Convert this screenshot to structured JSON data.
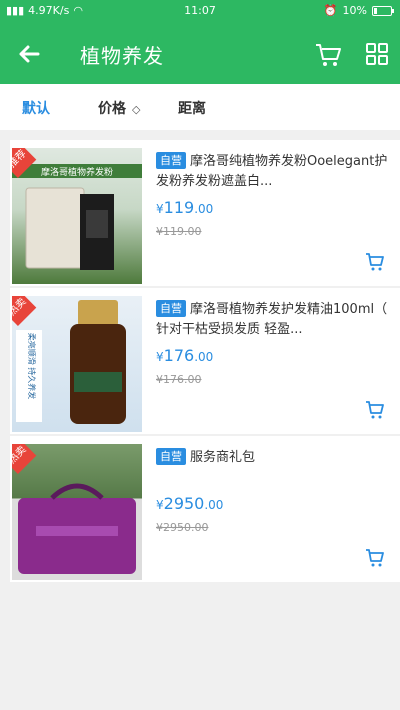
{
  "status_bar": {
    "network": "4.97K/s",
    "time": "11:07",
    "battery": "10%"
  },
  "header": {
    "title": "植物养发"
  },
  "sort_tabs": [
    {
      "label": "默认",
      "active": true
    },
    {
      "label": "价格",
      "active": false
    },
    {
      "label": "距离",
      "active": false
    }
  ],
  "sort_arrow": "◇",
  "products": [
    {
      "tag": "自营",
      "title": "摩洛哥纯植物养发粉Ooelegant护发粉养发粉遮盖白...",
      "price_symbol": "¥",
      "price_int": "119",
      "price_dec": ".00",
      "old_price": "¥119.00",
      "badge": "推荐",
      "thumb_caption": "摩洛哥植物养发粉"
    },
    {
      "tag": "自营",
      "title": "摩洛哥植物养发护发精油100ml（ 针对干枯受损发质 轻盈...",
      "price_symbol": "¥",
      "price_int": "176",
      "price_dec": ".00",
      "old_price": "¥176.00",
      "badge": "热卖",
      "thumb_caption": "柔亮顺滑 持久养发"
    },
    {
      "tag": "自营",
      "title": "服务商礼包",
      "price_symbol": "¥",
      "price_int": "2950",
      "price_dec": ".00",
      "old_price": "¥2950.00",
      "badge": "热卖",
      "thumb_caption": ""
    }
  ],
  "colors": {
    "brand_green": "#2db862",
    "accent_blue": "#2a8de0",
    "hot_red": "#e8443a"
  }
}
